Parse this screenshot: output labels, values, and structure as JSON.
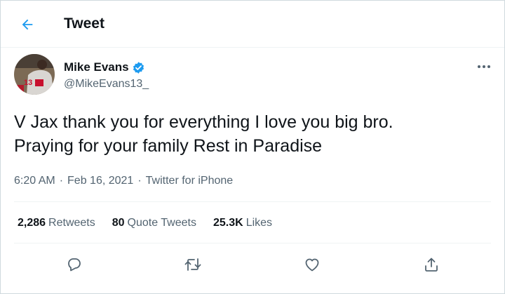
{
  "header": {
    "title": "Tweet",
    "back_icon": "arrow-left-icon"
  },
  "author": {
    "name": "Mike Evans",
    "handle": "@MikeEvans13_",
    "verified": true
  },
  "tweet": {
    "line1": "V Jax thank you for everything I love you big bro.",
    "line2": "Praying for your family Rest in Paradise"
  },
  "meta": {
    "time": "6:20 AM",
    "separator": "·",
    "date": "Feb 16, 2021",
    "source": "Twitter for iPhone"
  },
  "stats": {
    "retweets": {
      "count": "2,286",
      "label": "Retweets"
    },
    "quote_tweets": {
      "count": "80",
      "label": "Quote Tweets"
    },
    "likes": {
      "count": "25.3K",
      "label": "Likes"
    }
  },
  "actions": [
    "reply-icon",
    "retweet-icon",
    "like-icon",
    "share-icon"
  ],
  "colors": {
    "accent": "#1d9bf0",
    "text": "#0f1419",
    "secondary": "#536471",
    "border": "#eff3f4"
  }
}
